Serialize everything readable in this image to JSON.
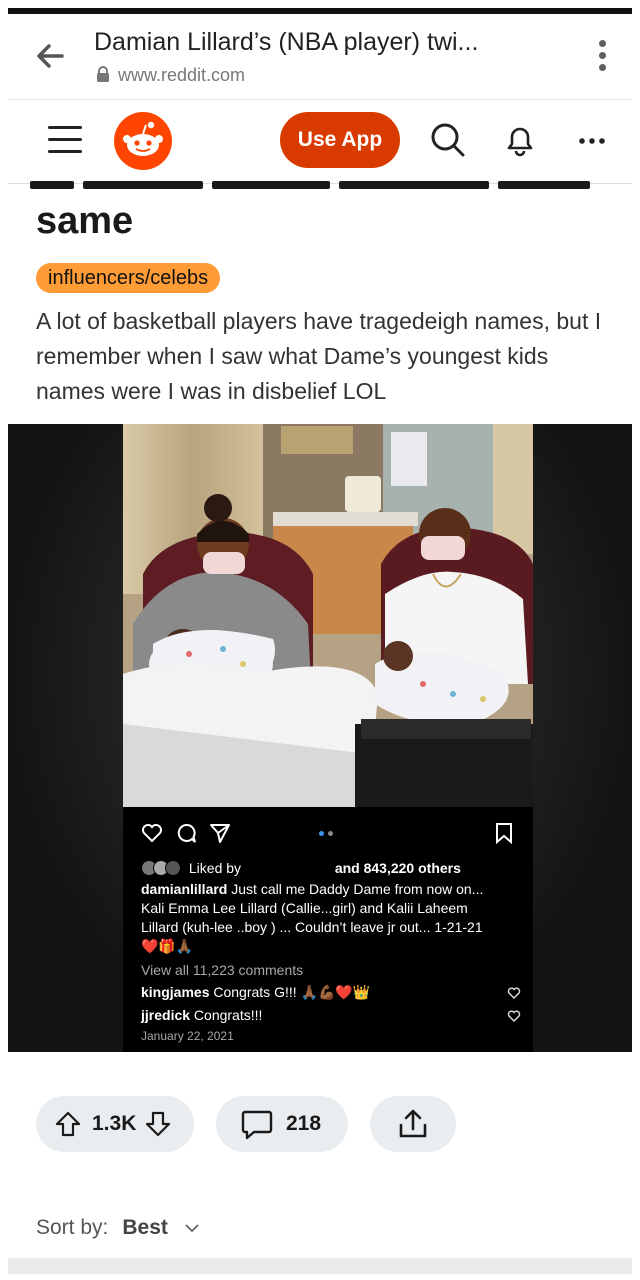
{
  "browser": {
    "title": "Damian Lillard’s (NBA player) twi...",
    "url": "www.reddit.com"
  },
  "nav": {
    "use_app": "Use App"
  },
  "post": {
    "title": "same",
    "flair": "influencers/celebs",
    "body": "A lot of basketball players have tragedeigh names, but I remember when I saw what Dame’s youngest kids names were I was in disbelief LOL"
  },
  "instagram": {
    "liked_by": "Liked by",
    "liked_others": "and 843,220 others",
    "caption_user": "damianlillard",
    "caption_line1": "Just call me Daddy Dame from now on...",
    "caption_line2": "Kali Emma Lee Lillard (Callie...girl) and Kalii Laheem",
    "caption_line3": "Lillard (kuh-lee ..boy ) ... Couldn’t leave jr out... 1-21-21",
    "caption_emojis": "❤️🎁🙏🏾",
    "view_comments": "View all 11,223 comments",
    "comments": [
      {
        "user": "kingjames",
        "text": "Congrats G!!! 🙏🏾💪🏾❤️👑"
      },
      {
        "user": "jjredick",
        "text": "Congrats!!!"
      }
    ],
    "date": "January 22, 2021"
  },
  "actions": {
    "votes": "1.3K",
    "comments": "218"
  },
  "sort": {
    "label": "Sort by:",
    "value": "Best"
  },
  "colors": {
    "reddit_orange": "#ff4500",
    "use_app_bg": "#d93a00",
    "flair_bg": "#ff9c36",
    "pill_bg": "#eaedef"
  }
}
